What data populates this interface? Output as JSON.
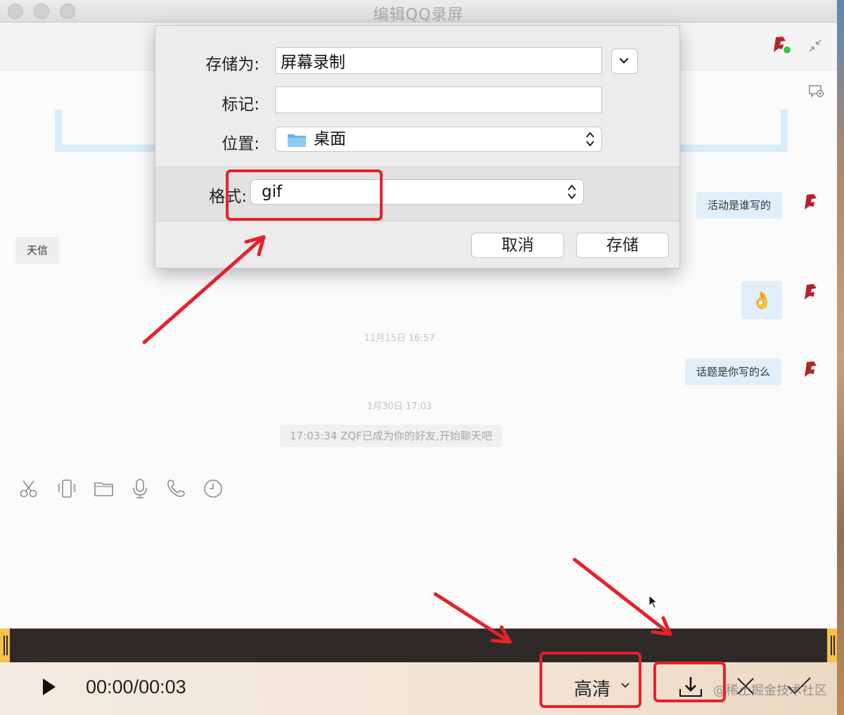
{
  "window": {
    "title": "编辑QQ录屏"
  },
  "chat": {
    "messages": [
      {
        "side": "right",
        "text": "活动是谁写的"
      },
      {
        "side": "left",
        "text": "天信"
      },
      {
        "side": "right",
        "text": "👌"
      },
      {
        "side": "right",
        "text": "话题是你写的么"
      }
    ],
    "timestamps": [
      "11月15日  16:57",
      "1月30日  17:03"
    ],
    "system_message": "17:03:34 ZQF已成为你的好友,开始聊天吧"
  },
  "save_dialog": {
    "save_as_label": "存储为:",
    "save_as_value": "屏幕录制",
    "tags_label": "标记:",
    "tags_value": "",
    "location_label": "位置:",
    "location_value": "桌面",
    "format_label": "格式:",
    "format_value": "gif",
    "cancel_label": "取消",
    "save_label": "存储"
  },
  "player": {
    "time_current": "00:00",
    "time_separator": "/",
    "time_total": "00:03",
    "quality_label": "高清"
  },
  "watermark": "@稀土掘金技术社区",
  "colors": {
    "annotation": "#e8202a",
    "status_online": "#2bc83d",
    "bubble_mine": "#e0effa"
  }
}
